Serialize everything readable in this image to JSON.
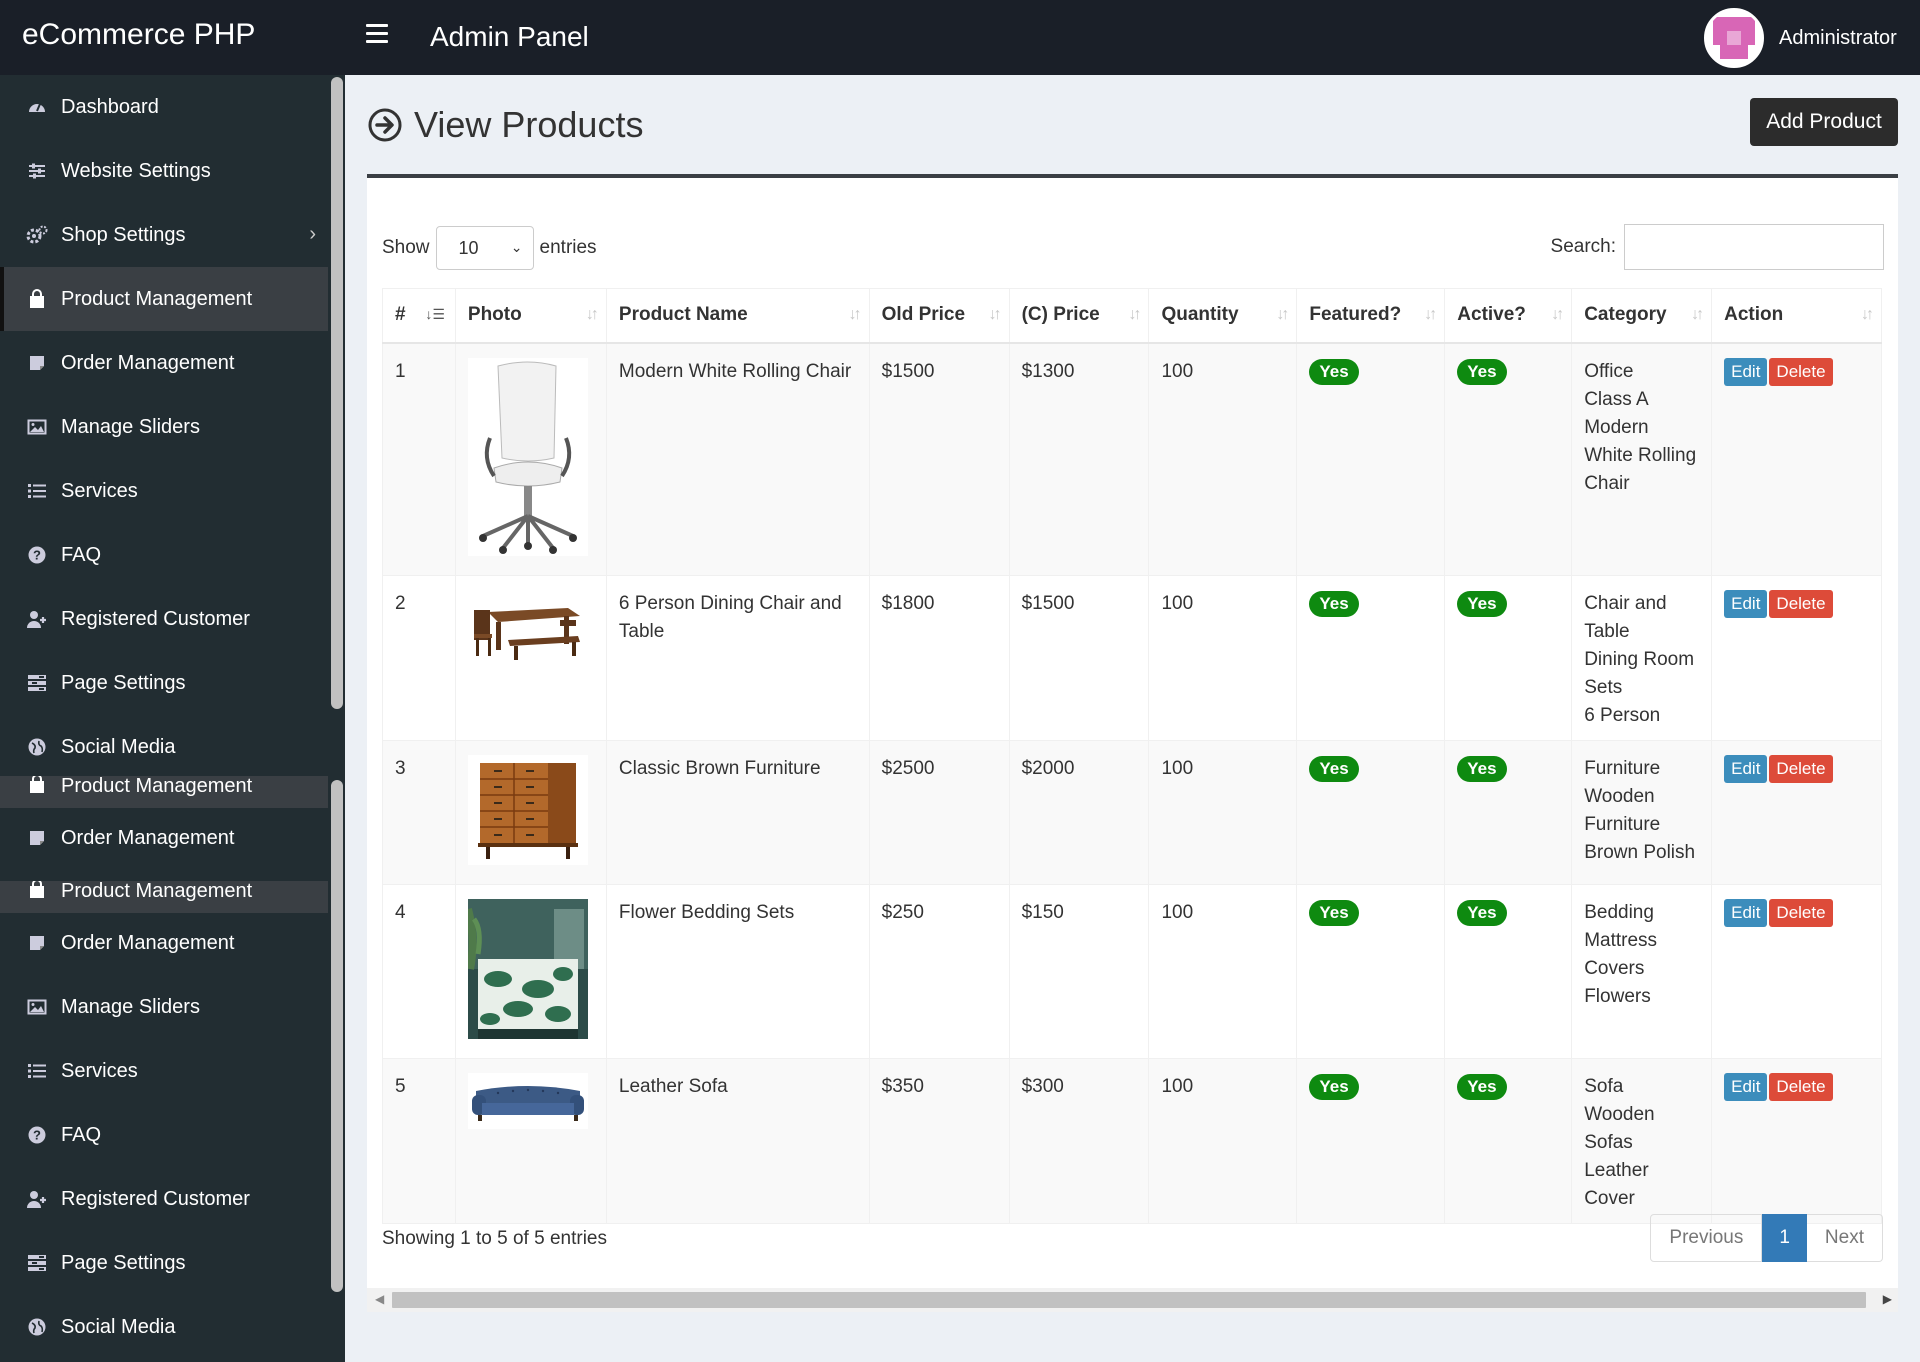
{
  "header": {
    "brand": "eCommerce PHP",
    "panel_title": "Admin Panel",
    "user_name": "Administrator"
  },
  "sidebar": {
    "items": [
      {
        "label": "Dashboard",
        "icon": "dashboard-icon"
      },
      {
        "label": "Website Settings",
        "icon": "sliders-icon"
      },
      {
        "label": "Shop Settings",
        "icon": "cogs-icon"
      },
      {
        "label": "Product Management",
        "icon": "shopping-bag-icon"
      },
      {
        "label": "Order Management",
        "icon": "sticky-note-icon"
      },
      {
        "label": "Manage Sliders",
        "icon": "image-icon"
      },
      {
        "label": "Services",
        "icon": "list-icon"
      },
      {
        "label": "FAQ",
        "icon": "question-circle-icon"
      },
      {
        "label": "Registered Customer",
        "icon": "user-plus-icon"
      },
      {
        "label": "Page Settings",
        "icon": "tasks-icon"
      },
      {
        "label": "Social Media",
        "icon": "globe-icon"
      },
      {
        "label": "Product Management",
        "icon": "shopping-bag-icon"
      },
      {
        "label": "Order Management",
        "icon": "sticky-note-icon"
      },
      {
        "label": "Product Management",
        "icon": "shopping-bag-icon"
      },
      {
        "label": "Order Management",
        "icon": "sticky-note-icon"
      },
      {
        "label": "Manage Sliders",
        "icon": "image-icon"
      },
      {
        "label": "Services",
        "icon": "list-icon"
      },
      {
        "label": "FAQ",
        "icon": "question-circle-icon"
      },
      {
        "label": "Registered Customer",
        "icon": "user-plus-icon"
      },
      {
        "label": "Page Settings",
        "icon": "tasks-icon"
      },
      {
        "label": "Social Media",
        "icon": "globe-icon"
      }
    ]
  },
  "page": {
    "title": "View Products",
    "add_button": "Add Product"
  },
  "table_controls": {
    "show_label": "Show",
    "length_value": "10",
    "entries_label": "entries",
    "search_label": "Search:",
    "search_value": ""
  },
  "table": {
    "columns": [
      "#",
      "Photo",
      "Product Name",
      "Old Price",
      "(C) Price",
      "Quantity",
      "Featured?",
      "Active?",
      "Category",
      "Action"
    ],
    "rows": [
      {
        "num": "1",
        "photo": "chair",
        "name": "Modern White Rolling Chair",
        "old_price": "$1500",
        "price": "$1300",
        "qty": "100",
        "featured": "Yes",
        "active": "Yes",
        "category": [
          "Office",
          "Class A",
          "Modern",
          "White Rolling",
          "Chair"
        ]
      },
      {
        "num": "2",
        "photo": "dining",
        "name": "6 Person Dining Chair and Table",
        "old_price": "$1800",
        "price": "$1500",
        "qty": "100",
        "featured": "Yes",
        "active": "Yes",
        "category": [
          "Chair and",
          "Table",
          "Dining Room",
          "Sets",
          "6 Person"
        ]
      },
      {
        "num": "3",
        "photo": "dresser",
        "name": "Classic Brown Furniture",
        "old_price": "$2500",
        "price": "$2000",
        "qty": "100",
        "featured": "Yes",
        "active": "Yes",
        "category": [
          "Furniture",
          "Wooden",
          "Furniture",
          "Brown Polish"
        ]
      },
      {
        "num": "4",
        "photo": "bedding",
        "name": "Flower Bedding Sets",
        "old_price": "$250",
        "price": "$150",
        "qty": "100",
        "featured": "Yes",
        "active": "Yes",
        "category": [
          "Bedding",
          "Mattress",
          "Covers",
          "Flowers"
        ]
      },
      {
        "num": "5",
        "photo": "sofa",
        "name": "Leather Sofa",
        "old_price": "$350",
        "price": "$300",
        "qty": "100",
        "featured": "Yes",
        "active": "Yes",
        "category": [
          "Sofa",
          "Wooden",
          "Sofas",
          "Leather",
          "Cover"
        ]
      }
    ],
    "edit_label": "Edit",
    "delete_label": "Delete"
  },
  "footer": {
    "info": "Showing 1 to 5 of 5 entries",
    "previous": "Previous",
    "current_page": "1",
    "next": "Next"
  },
  "colors": {
    "topbar": "#1a1f28",
    "sidebar": "#222d32",
    "badge_green": "#0e8a10",
    "edit_blue": "#3c8dbc",
    "delete_red": "#dd4b39",
    "page_active": "#337ab7"
  }
}
